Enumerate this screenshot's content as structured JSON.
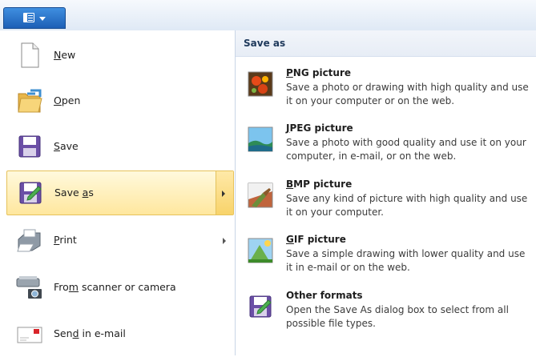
{
  "menu": {
    "items": [
      {
        "prefix": "",
        "accel": "N",
        "suffix": "ew",
        "icon": "new-document-icon"
      },
      {
        "prefix": "",
        "accel": "O",
        "suffix": "pen",
        "icon": "open-folder-icon"
      },
      {
        "prefix": "",
        "accel": "S",
        "suffix": "ave",
        "icon": "save-disk-icon"
      },
      {
        "prefix": "Save ",
        "accel": "a",
        "suffix": "s",
        "icon": "save-as-icon",
        "selected": true,
        "submenu": true
      },
      {
        "prefix": "",
        "accel": "P",
        "suffix": "rint",
        "icon": "printer-icon",
        "submenu": true
      },
      {
        "prefix": "Fro",
        "accel": "m",
        "suffix": " scanner or camera",
        "icon": "scanner-camera-icon"
      },
      {
        "prefix": "Sen",
        "accel": "d",
        "suffix": " in e-mail",
        "icon": "email-icon"
      }
    ]
  },
  "save_as_panel": {
    "title": "Save as",
    "formats": [
      {
        "accel": "P",
        "rest": "NG picture",
        "description": "Save a photo or drawing with high quality and use it on your computer or on the web.",
        "icon": "png-picture-icon"
      },
      {
        "accel": "J",
        "rest": "PEG picture",
        "description": "Save a photo with good quality and use it on your computer, in e-mail, or on the web.",
        "icon": "jpeg-picture-icon"
      },
      {
        "accel": "B",
        "rest": "MP picture",
        "description": "Save any kind of picture with high quality and use it on your computer.",
        "icon": "bmp-picture-icon"
      },
      {
        "accel": "G",
        "rest": "IF picture",
        "description": "Save a simple drawing with lower quality and use it in e-mail or on the web.",
        "icon": "gif-picture-icon"
      },
      {
        "accel": "",
        "rest": "Other formats",
        "description": "Open the Save As dialog box to select from all possible file types.",
        "icon": "other-formats-icon"
      }
    ]
  },
  "colors": {
    "app_button": "#1d5fb6",
    "selection_fill": "#ffe79e",
    "selection_border": "#e6c25a",
    "panel_header_text": "#1e395b"
  }
}
